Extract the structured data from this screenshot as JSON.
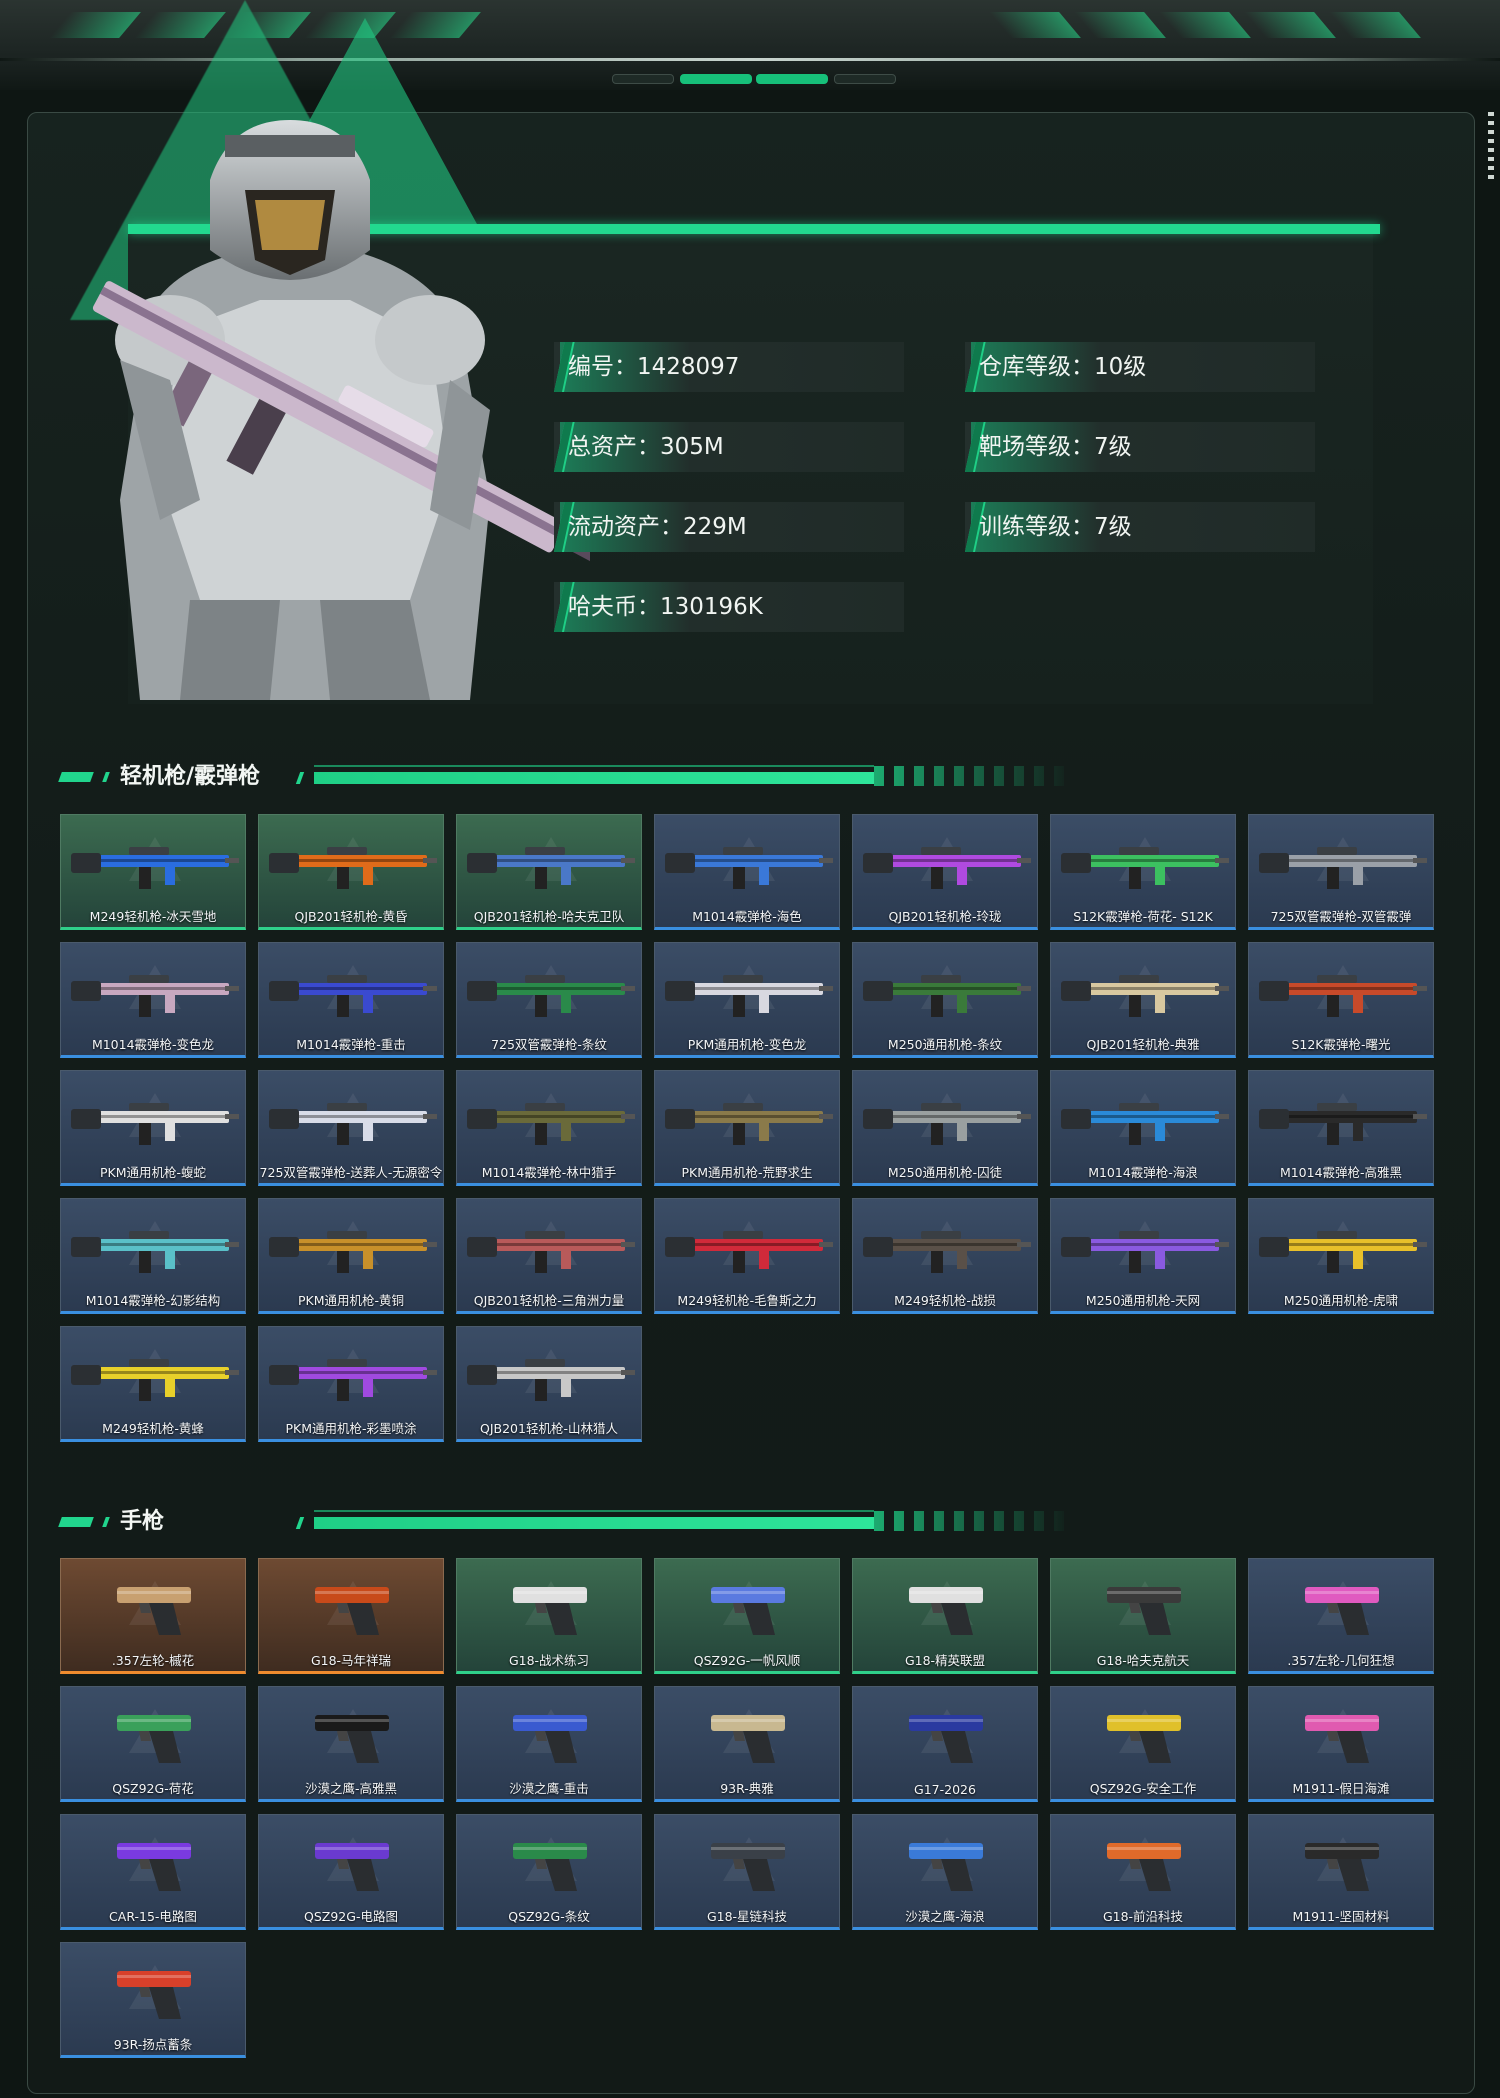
{
  "profile": {
    "stats": [
      {
        "label": "编号：1428097"
      },
      {
        "label": "仓库等级：10级"
      },
      {
        "label": "总资产：305M"
      },
      {
        "label": "靶场等级：7级"
      },
      {
        "label": "流动资产：229M"
      },
      {
        "label": "训练等级：7级"
      },
      {
        "label": "哈夫币：130196K"
      }
    ]
  },
  "sections": {
    "lmg_title": "轻机枪/霰弹枪",
    "pistol_title": "手枪"
  },
  "lmg_items": [
    {
      "name": "M249轻机枪-冰天雪地",
      "rarity": "green",
      "accent": "#2a6de0"
    },
    {
      "name": "QJB201轻机枪-黄昏",
      "rarity": "green",
      "accent": "#e06b1a"
    },
    {
      "name": "QJB201轻机枪-哈夫克卫队",
      "rarity": "green",
      "accent": "#4a78c8"
    },
    {
      "name": "M1014霰弹枪-海色",
      "rarity": "blue",
      "accent": "#3a78d8"
    },
    {
      "name": "QJB201轻机枪-玲珑",
      "rarity": "blue",
      "accent": "#b04ae0"
    },
    {
      "name": "S12K霰弹枪-荷花- S12K",
      "rarity": "blue",
      "accent": "#3cc060"
    },
    {
      "name": "725双管霰弹枪-双管霰弹",
      "rarity": "blue",
      "accent": "#9aa0a8"
    },
    {
      "name": "M1014霰弹枪-变色龙",
      "rarity": "blue",
      "accent": "#c8a8c0"
    },
    {
      "name": "M1014霰弹枪-重击",
      "rarity": "blue",
      "accent": "#3a4ad0"
    },
    {
      "name": "725双管霰弹枪-条纹",
      "rarity": "blue",
      "accent": "#2a8a4a"
    },
    {
      "name": "PKM通用机枪-变色龙",
      "rarity": "blue",
      "accent": "#d8d8e0"
    },
    {
      "name": "M250通用机枪-条纹",
      "rarity": "blue",
      "accent": "#3a7a3a"
    },
    {
      "name": "QJB201轻机枪-典雅",
      "rarity": "blue",
      "accent": "#d8c8a0"
    },
    {
      "name": "S12K霰弹枪-曙光",
      "rarity": "blue",
      "accent": "#c84a2a"
    },
    {
      "name": "PKM通用机枪-蝮蛇",
      "rarity": "blue",
      "accent": "#e0e0e0"
    },
    {
      "name": "725双管霰弹枪-送葬人-无源密令",
      "rarity": "blue",
      "accent": "#d8dce8"
    },
    {
      "name": "M1014霰弹枪-林中猎手",
      "rarity": "blue",
      "accent": "#6a6a3a"
    },
    {
      "name": "PKM通用机枪-荒野求生",
      "rarity": "blue",
      "accent": "#8a7a4a"
    },
    {
      "name": "M250通用机枪-囚徒",
      "rarity": "blue",
      "accent": "#9aa0a0"
    },
    {
      "name": "M1014霰弹枪-海浪",
      "rarity": "blue",
      "accent": "#2a8ad8"
    },
    {
      "name": "M1014霰弹枪-高雅黑",
      "rarity": "blue",
      "accent": "#2a2a2a"
    },
    {
      "name": "M1014霰弹枪-幻影结构",
      "rarity": "blue",
      "accent": "#5ac0c8"
    },
    {
      "name": "PKM通用机枪-黄铜",
      "rarity": "blue",
      "accent": "#c8902a"
    },
    {
      "name": "QJB201轻机枪-三角洲力量",
      "rarity": "blue",
      "accent": "#b85a5a"
    },
    {
      "name": "M249轻机枪-毛鲁斯之力",
      "rarity": "blue",
      "accent": "#d02a3a"
    },
    {
      "name": "M249轻机枪-战损",
      "rarity": "blue",
      "accent": "#5a5048"
    },
    {
      "name": "M250通用机枪-天网",
      "rarity": "blue",
      "accent": "#8a5ae0"
    },
    {
      "name": "M250通用机枪-虎啸",
      "rarity": "blue",
      "accent": "#e8c02a"
    },
    {
      "name": "M249轻机枪-黄蜂",
      "rarity": "blue",
      "accent": "#e8d02a"
    },
    {
      "name": "PKM通用机枪-彩墨喷涂",
      "rarity": "blue",
      "accent": "#a04ae0"
    },
    {
      "name": "QJB201轻机枪-山林猎人",
      "rarity": "blue",
      "accent": "#c8c8c8"
    }
  ],
  "pistol_items": [
    {
      "name": ".357左轮-槭花",
      "rarity": "gold",
      "accent": "#c8a070"
    },
    {
      "name": "G18-马年祥瑞",
      "rarity": "gold",
      "accent": "#c84a1a"
    },
    {
      "name": "G18-战术练习",
      "rarity": "green",
      "accent": "#e0e0e0"
    },
    {
      "name": "QSZ92G-一帆风顺",
      "rarity": "green",
      "accent": "#5a7ae0"
    },
    {
      "name": "G18-精英联盟",
      "rarity": "green",
      "accent": "#e0e0e0"
    },
    {
      "name": "G18-哈夫克航天",
      "rarity": "green",
      "accent": "#3a3a3a"
    },
    {
      "name": ".357左轮-几何狂想",
      "rarity": "blue",
      "accent": "#e05ac0"
    },
    {
      "name": "QSZ92G-荷花",
      "rarity": "blue",
      "accent": "#3aa05a"
    },
    {
      "name": "沙漠之鹰-高雅黑",
      "rarity": "blue",
      "accent": "#1a1a1a"
    },
    {
      "name": "沙漠之鹰-重击",
      "rarity": "blue",
      "accent": "#3a5ad0"
    },
    {
      "name": "93R-典雅",
      "rarity": "blue",
      "accent": "#c8b890"
    },
    {
      "name": "G17-2026",
      "rarity": "blue",
      "accent": "#2a3aa0"
    },
    {
      "name": "QSZ92G-安全工作",
      "rarity": "blue",
      "accent": "#e0c02a"
    },
    {
      "name": "M1911-假日海滩",
      "rarity": "blue",
      "accent": "#e05ab0"
    },
    {
      "name": "CAR-15-电路图",
      "rarity": "blue",
      "accent": "#7a3ae0"
    },
    {
      "name": "QSZ92G-电路图",
      "rarity": "blue",
      "accent": "#6a3ad0"
    },
    {
      "name": "QSZ92G-条纹",
      "rarity": "blue",
      "accent": "#2a8a4a"
    },
    {
      "name": "G18-星链科技",
      "rarity": "blue",
      "accent": "#3a4048"
    },
    {
      "name": "沙漠之鹰-海浪",
      "rarity": "blue",
      "accent": "#3a7ad8"
    },
    {
      "name": "G18-前沿科技",
      "rarity": "blue",
      "accent": "#e06a2a"
    },
    {
      "name": "M1911-坚固材料",
      "rarity": "blue",
      "accent": "#2a2a2a"
    },
    {
      "name": "93R-扬点蓄条",
      "rarity": "blue",
      "accent": "#d8402a"
    }
  ]
}
